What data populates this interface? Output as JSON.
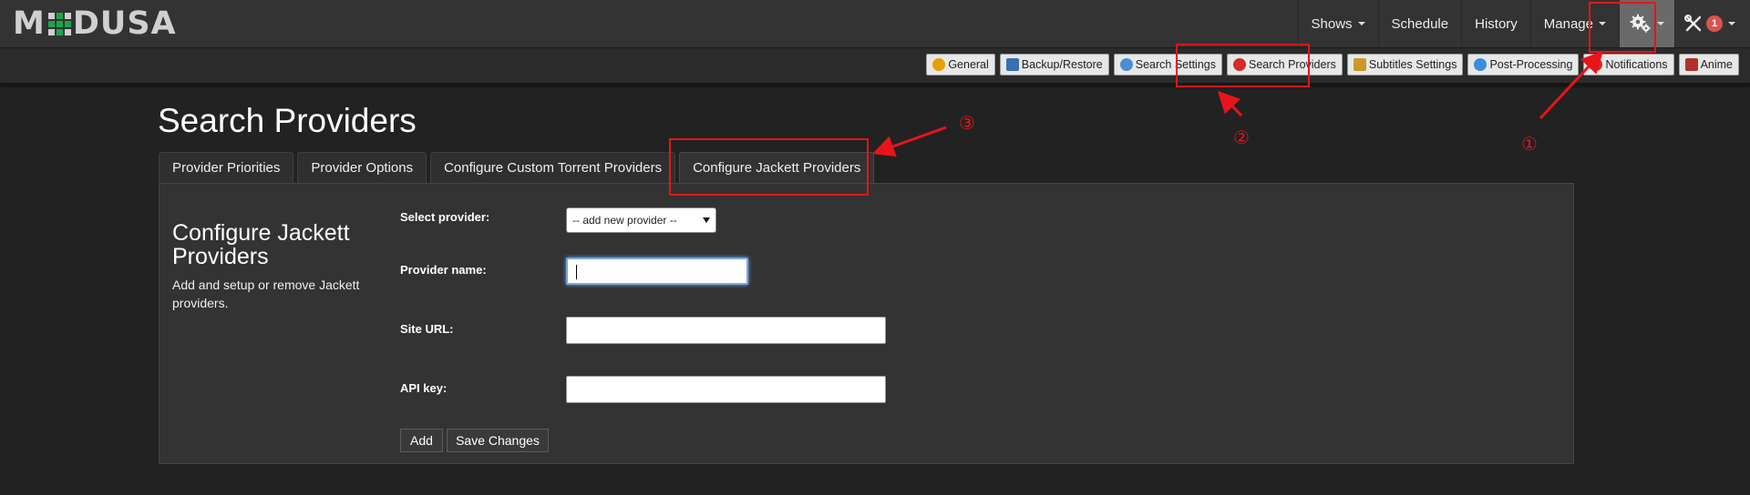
{
  "app": {
    "logo_prefix": "M",
    "logo_suffix": "DUSA"
  },
  "nav": {
    "shows": "Shows",
    "schedule": "Schedule",
    "history": "History",
    "manage": "Manage",
    "notifications_count": "1"
  },
  "subnav": [
    {
      "label": "General",
      "icon": "gear-icon",
      "color": "#e6a100"
    },
    {
      "label": "Backup/Restore",
      "icon": "disk-icon",
      "color": "#3a6fb0"
    },
    {
      "label": "Search Settings",
      "icon": "magnifier-icon",
      "color": "#4a90d0"
    },
    {
      "label": "Search Providers",
      "icon": "provider-icon",
      "color": "#d42b2b"
    },
    {
      "label": "Subtitles Settings",
      "icon": "subtitles-icon",
      "color": "#c89a2a"
    },
    {
      "label": "Post-Processing",
      "icon": "refresh-icon",
      "color": "#3a8fd8"
    },
    {
      "label": "Notifications",
      "icon": "bell-icon",
      "color": "#d42b2b"
    },
    {
      "label": "Anime",
      "icon": "anime-icon",
      "color": "#b03030"
    }
  ],
  "page": {
    "title": "Search Providers"
  },
  "tabs": [
    {
      "label": "Provider Priorities"
    },
    {
      "label": "Provider Options"
    },
    {
      "label": "Configure Custom Torrent Providers"
    },
    {
      "label": "Configure Jackett Providers"
    }
  ],
  "section": {
    "heading": "Configure Jackett Providers",
    "description": "Add and setup or remove Jackett providers."
  },
  "form": {
    "select_provider_label": "Select provider:",
    "select_provider_value": "-- add new provider --",
    "provider_name_label": "Provider name:",
    "provider_name_value": "",
    "site_url_label": "Site URL:",
    "site_url_value": "",
    "api_key_label": "API key:",
    "api_key_value": "",
    "add_button": "Add",
    "save_button": "Save Changes"
  },
  "annotations": {
    "step1": "①",
    "step2": "②",
    "step3": "③",
    "color": "#e8141a"
  }
}
